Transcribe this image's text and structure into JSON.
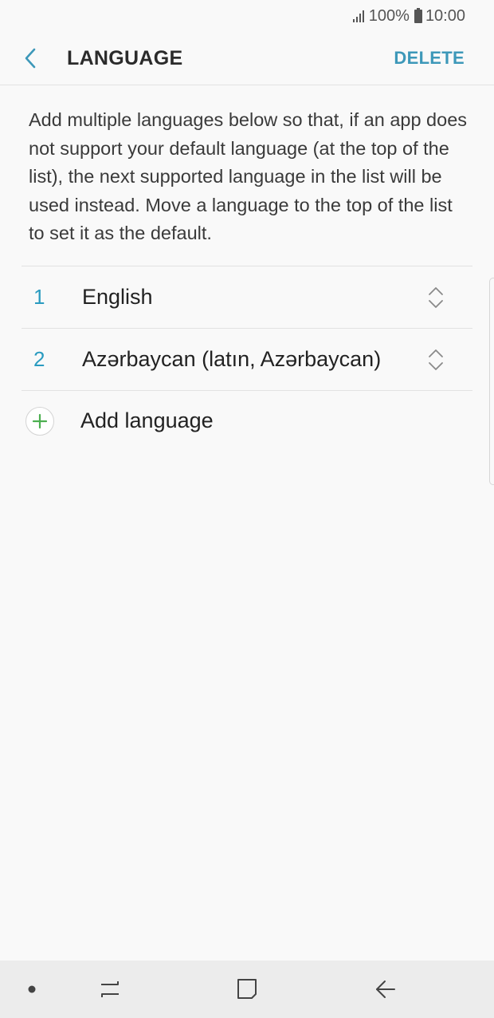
{
  "status_bar": {
    "battery_text": "100%",
    "time": "10:00"
  },
  "app_bar": {
    "title": "LANGUAGE",
    "delete_label": "DELETE"
  },
  "description": "Add multiple languages below so that, if an app does not support your default language (at the top of the list), the next supported language in the list will be used instead. Move a language to the top of the list to set it as the default.",
  "languages": [
    {
      "number": "1",
      "name": "English"
    },
    {
      "number": "2",
      "name": "Azərbaycan (latın, Azərbaycan)"
    }
  ],
  "add_language_label": "Add language",
  "colors": {
    "accent": "#2a9bc0",
    "delete": "#3d98b9",
    "add_plus": "#4caf50",
    "background": "#f9f9f9",
    "nav_bar": "#ececec"
  },
  "icons": {
    "back": "chevron-left-icon",
    "reorder": "up-down-chevron-icon",
    "add": "plus-icon",
    "nav_dot": "dot-icon",
    "recents": "recent-apps-icon",
    "home": "home-icon",
    "nav_back": "back-arrow-icon"
  }
}
